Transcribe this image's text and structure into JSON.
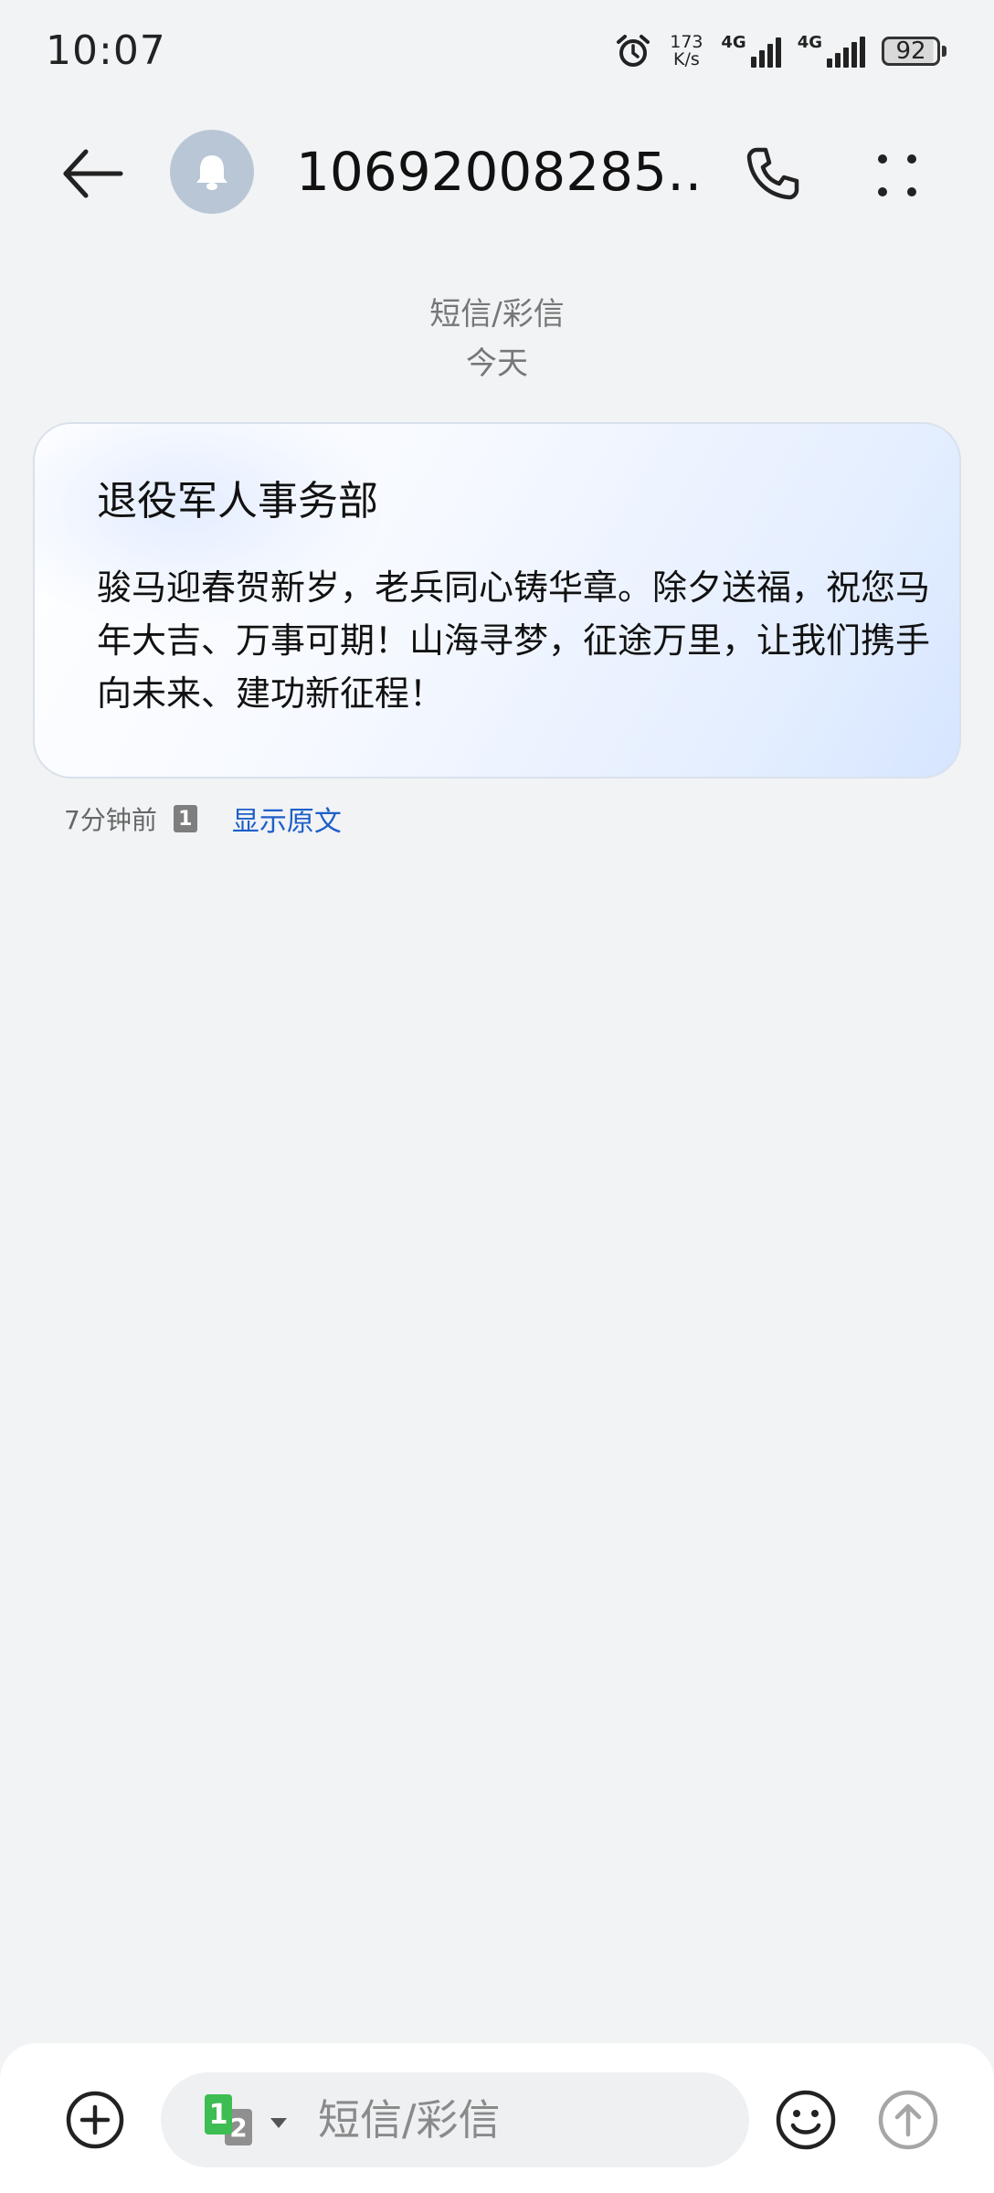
{
  "status_bar": {
    "time": "10:07",
    "net_speed_value": "173",
    "net_speed_unit": "K/s",
    "signal1_label": "4G",
    "signal2_label": "4G",
    "battery_level": "92",
    "icons": [
      "alarm-icon",
      "signal-icon",
      "signal-icon",
      "battery-icon"
    ]
  },
  "header": {
    "contact_name": "10692008285…",
    "icons": [
      "back-arrow-icon",
      "bell-icon",
      "phone-icon",
      "more-vertical-icon"
    ]
  },
  "conversation": {
    "type_label": "短信/彩信",
    "date_label": "今天"
  },
  "message": {
    "sender": "退役军人事务部",
    "body": "骏马迎春贺新岁，老兵同心铸华章。除夕送福，祝您马年大吉、万事可期！山海寻梦，征途万里，让我们携手向未来、建功新征程！",
    "time": "7分钟前",
    "sim_badge": "1",
    "show_original": "显示原文"
  },
  "input_bar": {
    "sim_primary": "1",
    "sim_secondary": "2",
    "placeholder": "短信/彩信",
    "icons": [
      "add-icon",
      "emoji-icon",
      "send-icon"
    ]
  },
  "colors": {
    "background": "#f1f3f5",
    "link": "#1e5fc8",
    "avatar": "#b8c6d6",
    "sim1": "#3ebd52",
    "sim2": "#8f8f8f"
  }
}
